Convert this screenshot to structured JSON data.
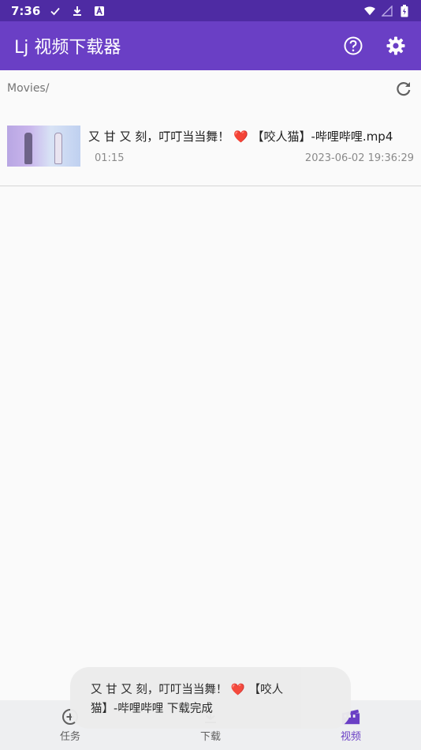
{
  "status_bar": {
    "time": "7:36",
    "icons_left": [
      "check-icon",
      "download-icon",
      "a-icon"
    ],
    "icons_right": [
      "wifi-icon",
      "signal-icon",
      "battery-icon"
    ]
  },
  "app_bar": {
    "title": "Lj 视频下载器",
    "background": "#6a3fc5",
    "actions": [
      "help-icon",
      "settings-icon"
    ]
  },
  "path": {
    "text": "Movies/"
  },
  "videos": [
    {
      "title": "又 甘 又 刻，叮叮当当舞！ ❤️ 【咬人猫】-哔哩哔哩.mp4",
      "duration": "01:15",
      "date": "2023-06-02 19:36:29"
    }
  ],
  "bottom_nav": {
    "items": [
      {
        "label": "任务",
        "icon": "add-circle-icon",
        "active": false
      },
      {
        "label": "下载",
        "icon": "download-icon",
        "active": false
      },
      {
        "label": "视频",
        "icon": "movie-icon",
        "active": true
      }
    ],
    "active_color": "#6a3fc5"
  },
  "toast": {
    "line1": "又 甘 又 刻，叮叮当当舞！ ❤️ 【咬人",
    "line2": "猫】-哔哩哔哩 下载完成"
  }
}
